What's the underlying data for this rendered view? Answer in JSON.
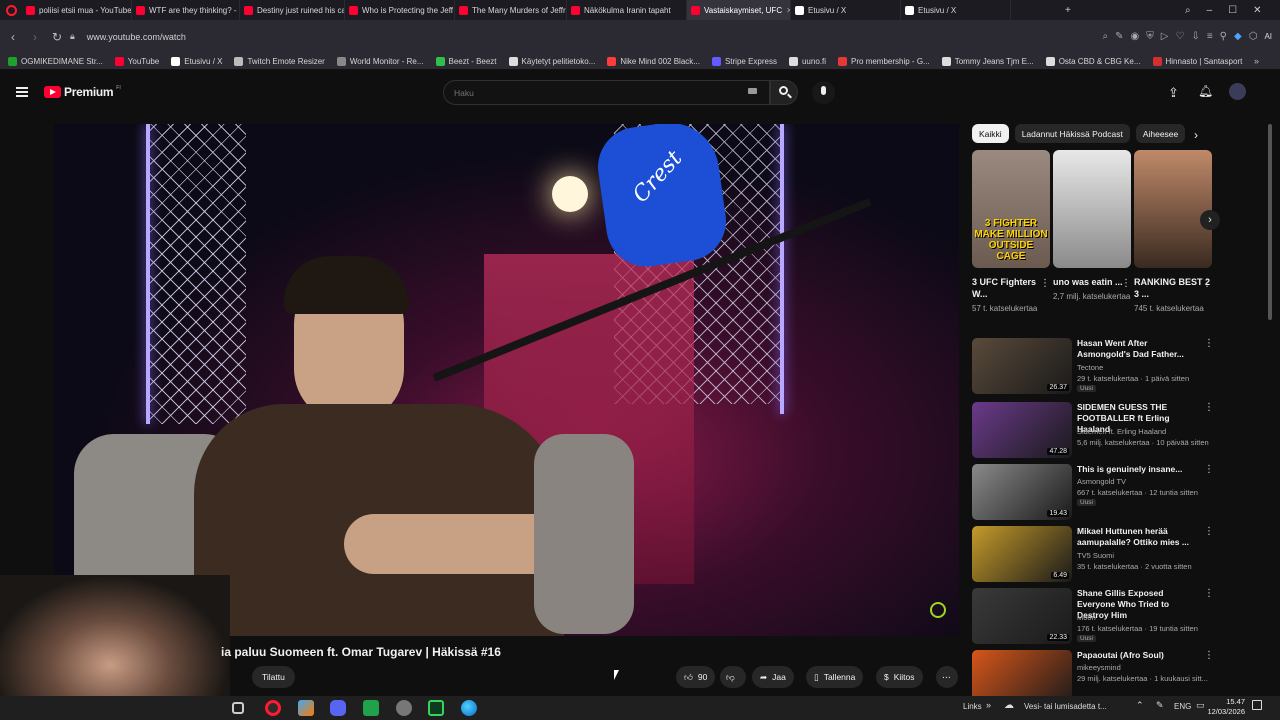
{
  "browser": {
    "tabs": [
      {
        "label": "poliisi etsii mua - YouTube",
        "color": "#ff0033"
      },
      {
        "label": "WTF are they thinking? - Y",
        "color": "#ff0033"
      },
      {
        "label": "Destiny just ruined his ca",
        "color": "#ff0033"
      },
      {
        "label": "Who is Protecting the Jeff",
        "color": "#ff0033"
      },
      {
        "label": "The Many Murders of Jeffr",
        "color": "#ff0033"
      },
      {
        "label": "Näkökulma Iranin tapaht",
        "color": "#ff0033"
      },
      {
        "label": "Vastaiskaymiset, UFC",
        "color": "#ff0033"
      },
      {
        "label": "Etusivu / X",
        "color": "#ffffff"
      },
      {
        "label": "Etusivu / X",
        "color": "#ffffff"
      }
    ],
    "url": "www.youtube.com/watch",
    "bookmarks": [
      {
        "label": "OGMIKEDIMANE Str...",
        "color": "#1ba12c"
      },
      {
        "label": "YouTube",
        "color": "#ff0033"
      },
      {
        "label": "Etusivu / X",
        "color": "#ffffff"
      },
      {
        "label": "Twitch Emote Resizer",
        "color": "#bbbbbb"
      },
      {
        "label": "World Monitor - Re...",
        "color": "#888888"
      },
      {
        "label": "Beezt - Beezt",
        "color": "#2fbf4a"
      },
      {
        "label": "Käytetyt pelitietoko...",
        "color": "#dddddd"
      },
      {
        "label": "Nike Mind 002 Black...",
        "color": "#ff3b3b"
      },
      {
        "label": "Stripe Express",
        "color": "#635bff"
      },
      {
        "label": "uuno.fi",
        "color": "#dddddd"
      },
      {
        "label": "Pro membership - G...",
        "color": "#e53935"
      },
      {
        "label": "Tommy Jeans Tjm E...",
        "color": "#dddddd"
      },
      {
        "label": "Osta CBD & CBG Ke...",
        "color": "#dddddd"
      },
      {
        "label": "Hinnasto | Santasport",
        "color": "#d32f2f"
      }
    ]
  },
  "youtube": {
    "logo": "Premium",
    "logo_sup": "FI",
    "search_placeholder": "Haku",
    "chips": [
      "Kaikki",
      "Ladannut Häkissä Podcast",
      "Aiheesee"
    ],
    "shorts": [
      {
        "title": "3 UFC Fighters W...",
        "views": "57 t. katselukertaa",
        "thumb_text": "3 FIGHTER MAKE MILLION OUTSIDE CAGE"
      },
      {
        "title": "uno was eatin ...",
        "views": "2,7 milj. katselukertaa",
        "thumb_text": ""
      },
      {
        "title": "RANKING BEST 2 3 ...",
        "views": "745 t. katselukertaa",
        "thumb_text": ""
      }
    ],
    "recommendations": [
      {
        "title": "Hasan Went After Asmongold's Dad Father...",
        "channel": "Tectone",
        "meta": "29 t. katselukertaa · 1 päivä sitten",
        "badge": "Uusi",
        "duration": "26.37",
        "thumb": "#5a4a3a"
      },
      {
        "title": "SIDEMEN GUESS THE FOOTBALLER ft Erling Haaland",
        "channel": "Sidemen ft. Erling Haaland",
        "meta": "5,6 milj. katselukertaa · 10 päivää sitten",
        "badge": "",
        "duration": "47.28",
        "thumb": "#6a3a8a"
      },
      {
        "title": "This is genuinely insane...",
        "channel": "Asmongold TV",
        "meta": "667 t. katselukertaa · 12 tuntia sitten",
        "badge": "Uusi",
        "duration": "19.43",
        "thumb": "#8a8a8a"
      },
      {
        "title": "Mikael Huttunen herää aamupalalle? Ottiko mies ...",
        "channel": "TV5 Suomi",
        "meta": "35 t. katselukertaa · 2 vuotta sitten",
        "badge": "",
        "duration": "6.49",
        "thumb": "#c49a2a"
      },
      {
        "title": "Shane Gillis Exposed Everyone Who Tried to Destroy Him",
        "channel": "Moon",
        "meta": "176 t. katselukertaa · 19 tuntia sitten",
        "badge": "Uusi",
        "duration": "22.33",
        "thumb": "#3a3a3a"
      },
      {
        "title": "Papaoutai (Afro Soul)",
        "channel": "mikeeysmind",
        "meta": "29 milj. katselukertaa · 1 kuukausi sitt...",
        "badge": "",
        "duration": "",
        "thumb": "#d8561a"
      }
    ],
    "video": {
      "title": "ia paluu Suomeen ft. Omar Tugarev | Häkissä #16",
      "subscribe": "Tilattu",
      "likes": "90",
      "share": "Jaa",
      "save": "Tallenna",
      "thanks": "Kiitos",
      "glove_text": "Crest"
    }
  },
  "taskbar": {
    "links": "Links",
    "weather": "Vesi- tai lumisadetta t...",
    "lang": "ENG",
    "time": "15.47",
    "date": "12/03/2026"
  }
}
